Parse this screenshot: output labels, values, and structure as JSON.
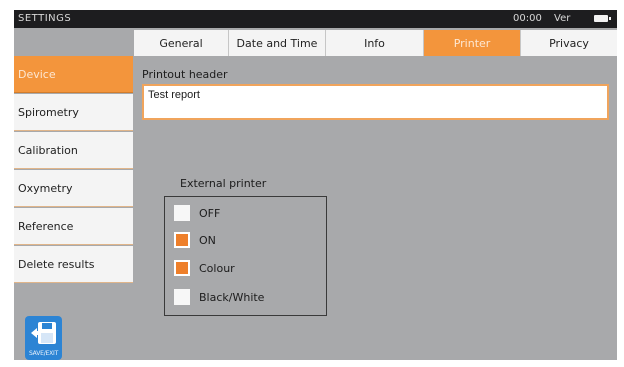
{
  "topbar": {
    "title": "SETTINGS",
    "time": "00:00",
    "version": "Ver"
  },
  "tabs": [
    {
      "label": "General",
      "active": false
    },
    {
      "label": "Date and Time",
      "active": false
    },
    {
      "label": "Info",
      "active": false
    },
    {
      "label": "Printer",
      "active": true
    },
    {
      "label": "Privacy",
      "active": false
    }
  ],
  "sidebar": {
    "items": [
      {
        "label": "Device",
        "active": true
      },
      {
        "label": "Spirometry",
        "active": false
      },
      {
        "label": "Calibration",
        "active": false
      },
      {
        "label": "Oxymetry",
        "active": false
      },
      {
        "label": "Reference",
        "active": false
      },
      {
        "label": "Delete results",
        "active": false
      }
    ]
  },
  "printer": {
    "header_label": "Printout header",
    "header_value": "Test report",
    "external_label": "External printer",
    "options": [
      {
        "label": "OFF",
        "checked": false
      },
      {
        "label": "ON",
        "checked": true
      },
      {
        "label": "Colour",
        "checked": true
      },
      {
        "label": "Black/White",
        "checked": false
      }
    ]
  },
  "save_exit": {
    "label": "SAVE/EXIT",
    "icon": "floppy-disk-exit-icon"
  },
  "colors": {
    "accent": "#f3953c",
    "checkbox_fill": "#ee7f2a",
    "background": "#a8a9ab",
    "topbar": "#1d1d1f",
    "save_button": "#2c84d4"
  }
}
